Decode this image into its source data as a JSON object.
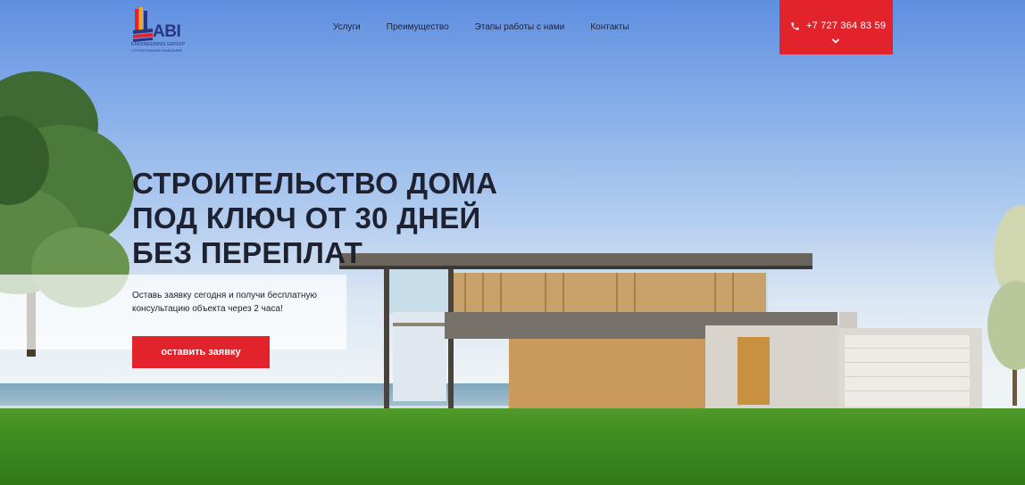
{
  "logo": {
    "name": "ABI",
    "subtitle": "ENGINEERING GROUP",
    "tagline": "СТРОИТЕЛЬНАЯ КОМПАНИЯ"
  },
  "nav": {
    "items": [
      {
        "label": "Услуги"
      },
      {
        "label": "Преимущество"
      },
      {
        "label": "Этапы работы с нами"
      },
      {
        "label": "Контакты"
      }
    ]
  },
  "contact": {
    "phone": "+7 727 364 83 59",
    "phone_icon": "phone-icon",
    "expand_icon": "chevron-down-icon"
  },
  "hero": {
    "title_lines": [
      "СТРОИТЕЛЬСТВО ДОМА",
      "ПОД КЛЮЧ ОТ 30 ДНЕЙ",
      "БЕЗ ПЕРЕПЛАТ"
    ],
    "lead_lines": [
      "Оставь заявку сегодня и получи бесплатную",
      "консультацию объекта через 2 часа!"
    ],
    "cta_label": "оставить заявку"
  },
  "colors": {
    "accent": "#e3232c",
    "brand": "#2a3680",
    "heading": "#1e2130"
  }
}
